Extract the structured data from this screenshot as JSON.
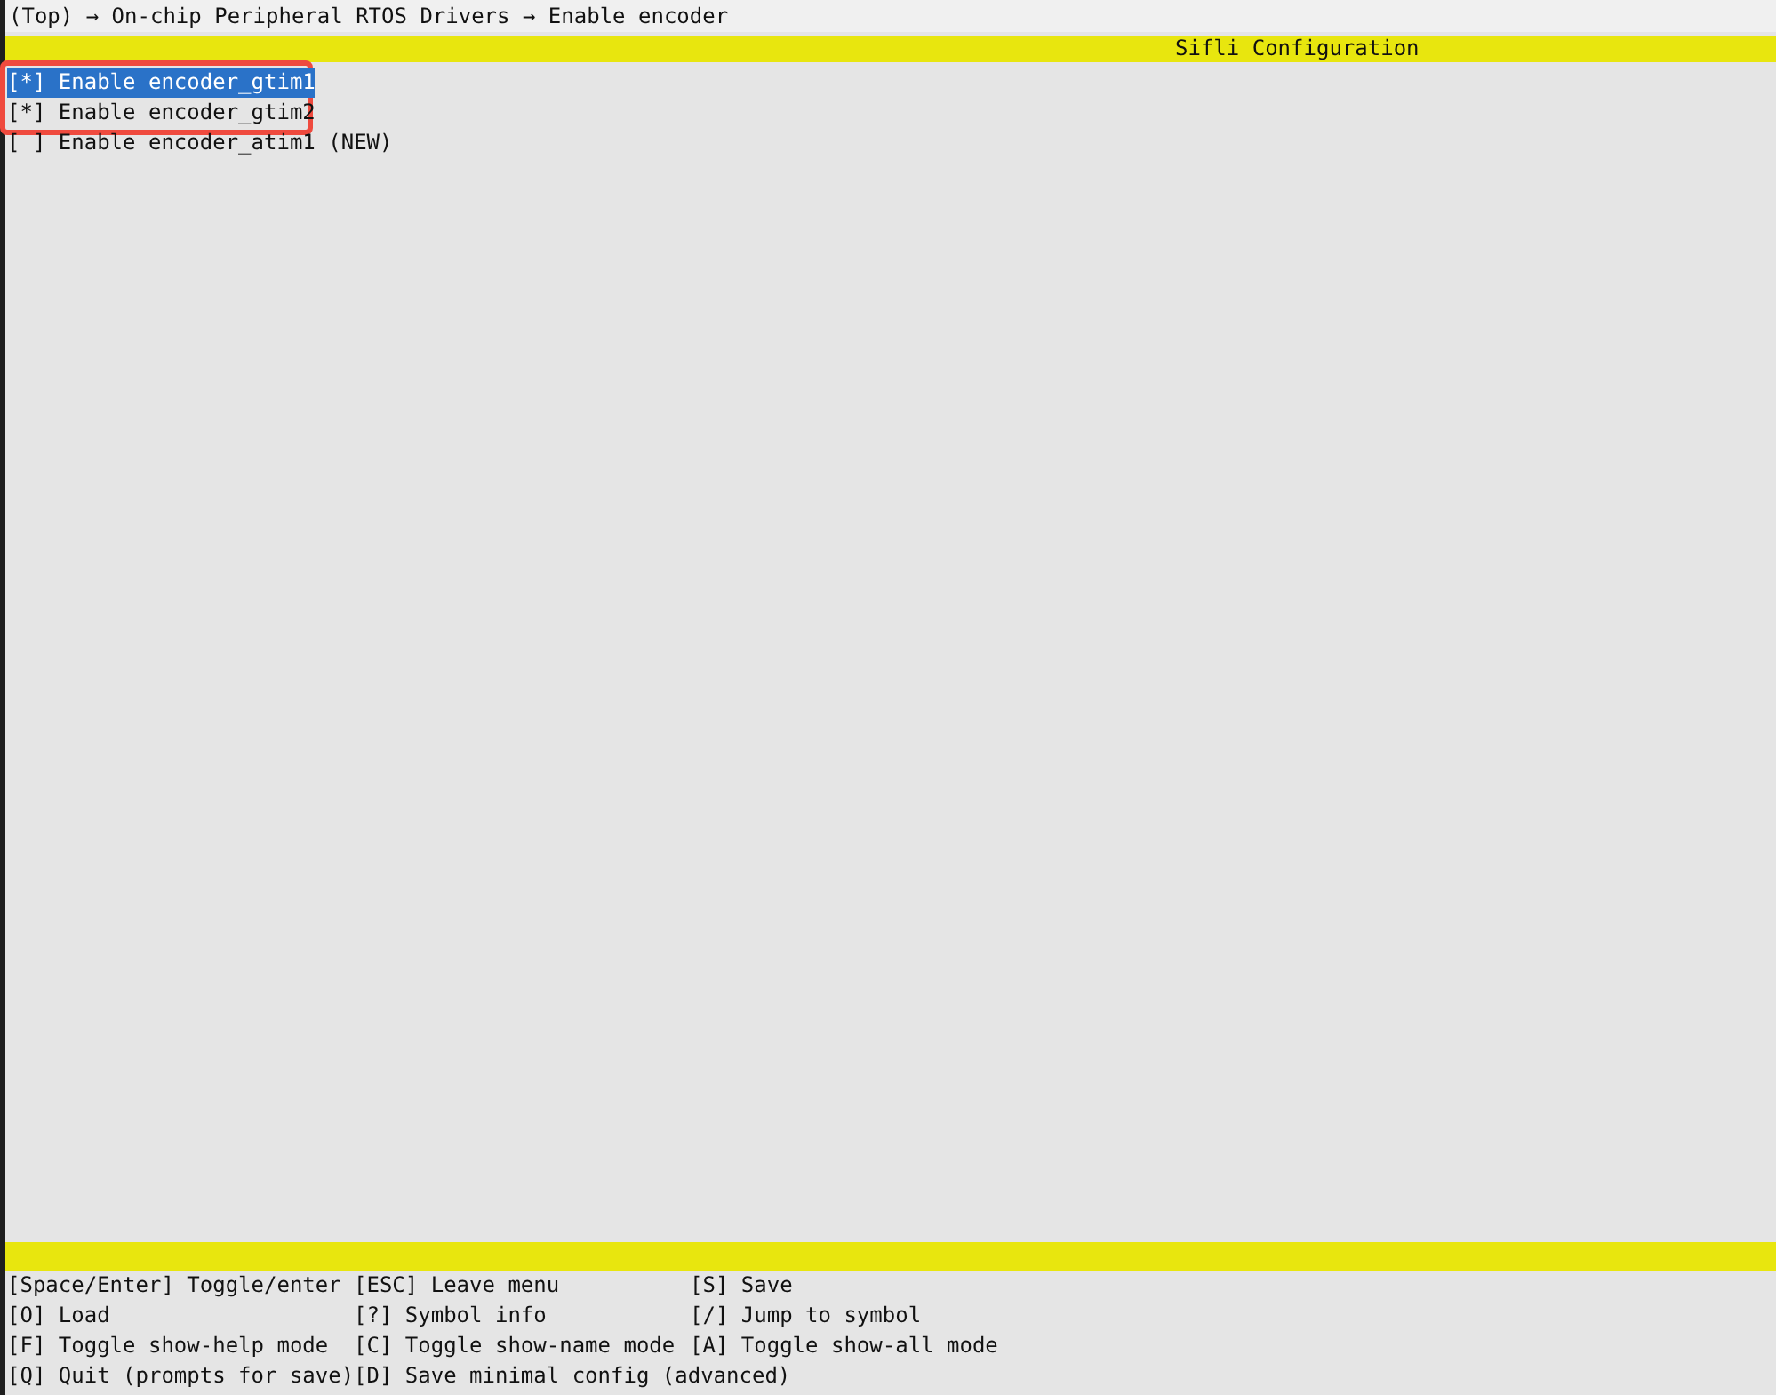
{
  "breadcrumb": "(Top) → On-chip Peripheral RTOS Drivers → Enable encoder",
  "title": "Sifli Configuration",
  "items": [
    {
      "box": "[*]",
      "label": "Enable encoder_gtim1",
      "selected": true
    },
    {
      "box": "[*]",
      "label": "Enable encoder_gtim2",
      "selected": false
    },
    {
      "box": "[ ]",
      "label": "Enable encoder_atim1 (NEW)",
      "selected": false
    }
  ],
  "shortcuts": [
    [
      "[Space/Enter] Toggle/enter",
      "[ESC] Leave menu",
      "[S] Save"
    ],
    [
      "[O] Load",
      "[?] Symbol info",
      "[/] Jump to symbol"
    ],
    [
      "[F] Toggle show-help mode",
      "[C] Toggle show-name mode",
      "[A] Toggle show-all mode"
    ],
    [
      "[Q] Quit (prompts for save)",
      "[D] Save minimal config (advanced)"
    ]
  ]
}
